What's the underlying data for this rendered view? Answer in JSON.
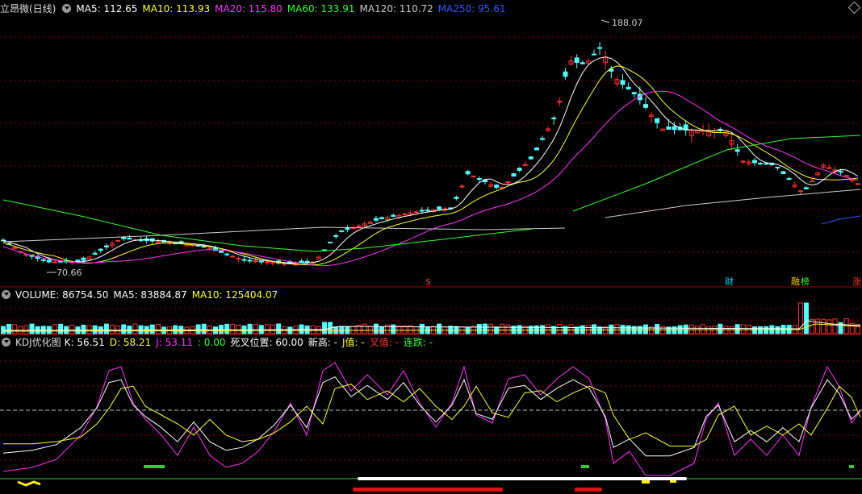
{
  "main": {
    "title": "立昂微(日线)",
    "ma": [
      {
        "label": "MA5: 112.65",
        "color": "#ffffff"
      },
      {
        "label": "MA10: 113.93",
        "color": "#ffff33"
      },
      {
        "label": "MA20: 115.80",
        "color": "#ff33ff"
      },
      {
        "label": "MA60: 133.91",
        "color": "#33ff33"
      },
      {
        "label": "MA120: 110.72",
        "color": "#cccccc"
      },
      {
        "label": "MA250: 95.61",
        "color": "#3355ff"
      }
    ],
    "high_label": "188.07",
    "low_label": "70.66",
    "events": [
      {
        "label": "$",
        "color": "#ff3333"
      },
      {
        "label": "财",
        "color": "#00ccff"
      },
      {
        "label": "融",
        "color": "#ffcc00"
      },
      {
        "label": "榜",
        "color": "#33ff33"
      },
      {
        "label": "涨",
        "color": "#ff3333"
      }
    ]
  },
  "volume": {
    "labels": [
      {
        "label": "VOLUME: 86754.50",
        "color": "#ffffff"
      },
      {
        "label": "MA5: 83884.87",
        "color": "#ffffff"
      },
      {
        "label": "MA10: 125404.07",
        "color": "#ffff33"
      }
    ]
  },
  "kdj": {
    "title": "KDJ优化图",
    "labels": [
      {
        "label": "K: 56.51",
        "color": "#ffffff"
      },
      {
        "label": "D: 58.21",
        "color": "#ffff33"
      },
      {
        "label": "J: 53.11",
        "color": "#ff33ff"
      },
      {
        "label": ": 0.00",
        "color": "#33ff33"
      },
      {
        "label": "死叉位置: 60.00",
        "color": "#ffffff"
      },
      {
        "label": "新高: -",
        "color": "#ffffff"
      },
      {
        "label": "J值: -",
        "color": "#ffff33"
      },
      {
        "label": "叉值: -",
        "color": "#ff3333"
      },
      {
        "label": "连跌: -",
        "color": "#33ff33"
      }
    ]
  },
  "colors": {
    "up": "#ff3232",
    "down": "#54ffff",
    "grid": "#8b0000"
  }
}
